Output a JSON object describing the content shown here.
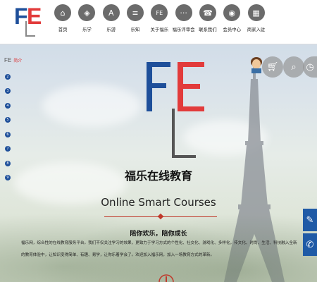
{
  "logo": {
    "text_f": "F",
    "text_e": "E",
    "text_l": "L"
  },
  "nav": [
    {
      "label": "首页",
      "icon": "home-icon",
      "glyph": "⌂"
    },
    {
      "label": "乐学",
      "icon": "graduation-cap-icon",
      "glyph": "◈"
    },
    {
      "label": "乐游",
      "icon": "tower-icon",
      "glyph": "A"
    },
    {
      "label": "乐知",
      "icon": "book-icon",
      "glyph": "≡"
    },
    {
      "label": "关于福乐",
      "icon": "fe-logo-icon",
      "glyph": "FE"
    },
    {
      "label": "福乐评审会",
      "icon": "chat-icon",
      "glyph": "···"
    },
    {
      "label": "联系我们",
      "icon": "phone-icon",
      "glyph": "☎"
    },
    {
      "label": "会员中心",
      "icon": "user-icon",
      "glyph": "◉"
    },
    {
      "label": "商家入驻",
      "icon": "shop-icon",
      "glyph": "▦"
    }
  ],
  "sidebar": {
    "fe": "FE",
    "label": "简介",
    "dots": [
      "2",
      "3",
      "4",
      "5",
      "6",
      "7",
      "8",
      "9"
    ]
  },
  "right_icons": {
    "cart": "cart-icon",
    "search": "search-icon",
    "time": "clock-icon"
  },
  "floating": {
    "edit": "edit-icon",
    "phone": "phone-icon"
  },
  "center": {
    "title": "福乐在线教育",
    "subtitle": "Online Smart Courses",
    "slogan": "陪你欢乐，陪你成长",
    "description": "福乐网，综合性的在线教育服务平台。我们不仅关注学习的效果，更致力于学习方式的个性化、社交化、游戏化、多样化，传文化、时尚、生活、科技融入全新的教育体验中，让知识变得简单、有趣、易学，让你乐着学会了。欢迎加入福乐网，加入一场教育方式的革新。"
  },
  "colors": {
    "blue": "#1e4f9a",
    "red": "#e23b3b",
    "accent": "#c0392b"
  }
}
